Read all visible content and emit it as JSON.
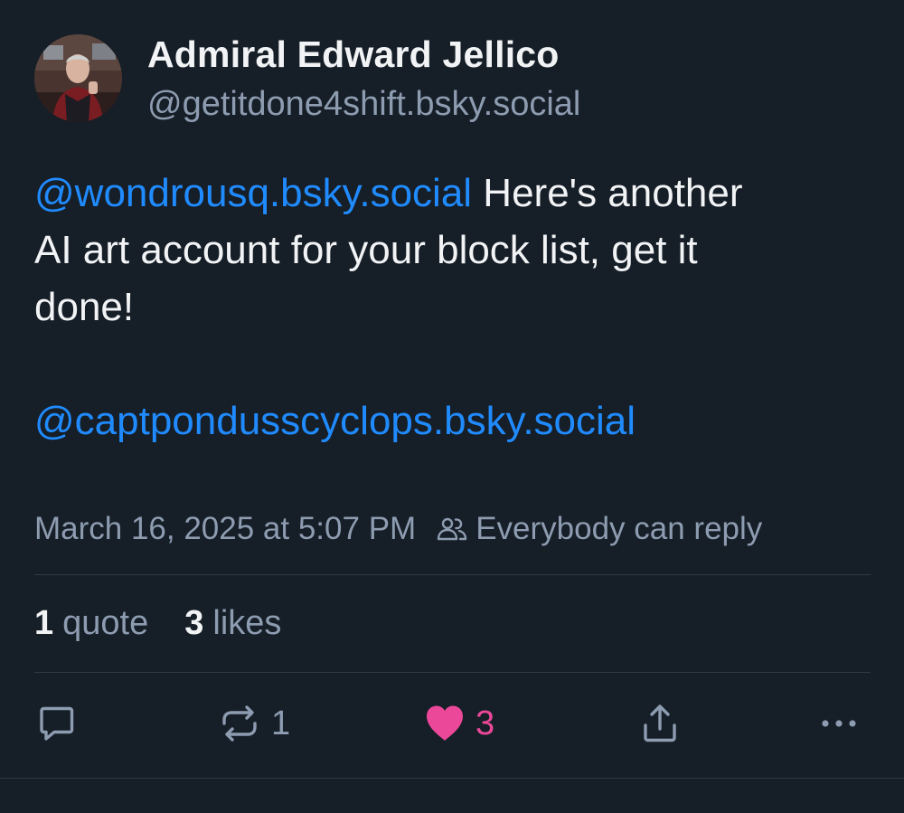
{
  "author": {
    "name": "Admiral Edward Jellico",
    "handle": "@getitdone4shift.bsky.social"
  },
  "post": {
    "line1_mention": "@wondrousq.bsky.social",
    "line1_text": " Here's another",
    "line2_text": "AI art account for your block list, get it",
    "line3_text": "done!",
    "line5_mention": "@captpondusscyclops.bsky.social"
  },
  "meta": {
    "timestamp": "March 16, 2025 at 5:07 PM",
    "reply_setting": "Everybody can reply",
    "reply_setting_icon": "people-icon"
  },
  "stats": {
    "quotes_count": "1",
    "quotes_label": "quote",
    "likes_count": "3",
    "likes_label": "likes"
  },
  "actions": {
    "reply_icon": "comment-icon",
    "repost_icon": "repost-icon",
    "repost_count": "1",
    "like_icon": "heart-filled-icon",
    "like_count": "3",
    "share_icon": "share-icon",
    "more_icon": "ellipsis-icon"
  },
  "colors": {
    "background": "#161e27",
    "text": "#f1f3f5",
    "muted": "#8d9cb0",
    "link": "#208bfe",
    "liked": "#ec4899",
    "divider": "#2e3a48"
  }
}
